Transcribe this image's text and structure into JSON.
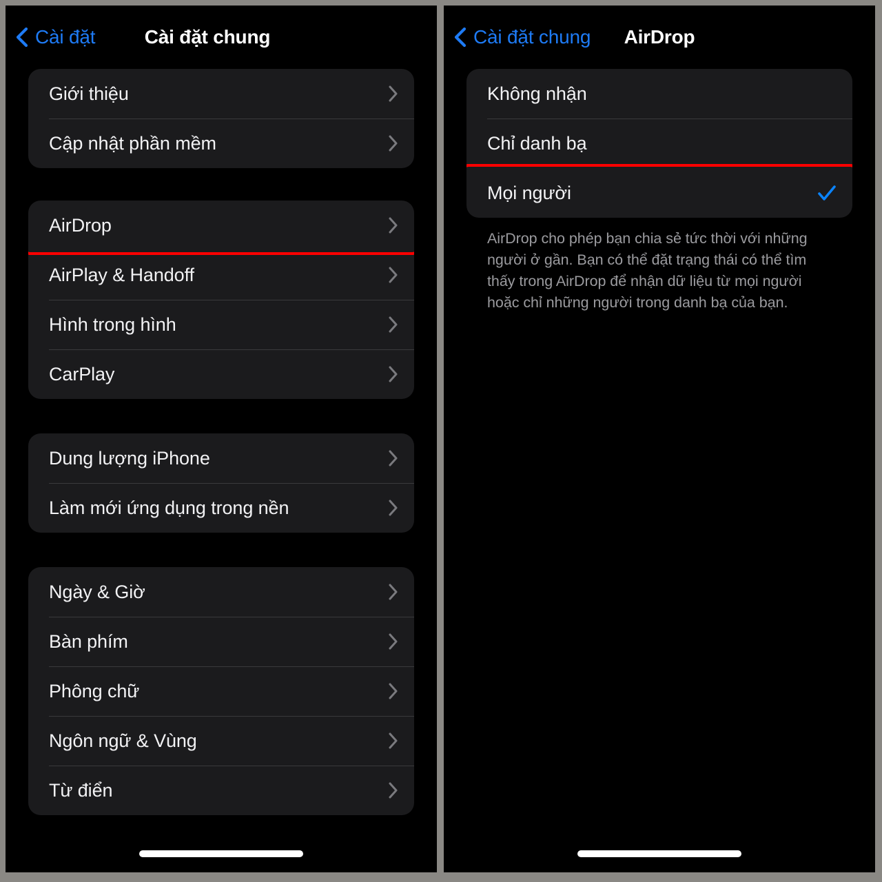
{
  "left_panel": {
    "nav": {
      "back_label": "Cài đặt",
      "title": "Cài đặt chung",
      "back_icon": "chevron-left-icon"
    },
    "groups": [
      {
        "rows": [
          {
            "label": "Giới thiệu",
            "accessory": "chevron-right-icon"
          },
          {
            "label": "Cập nhật phần mềm",
            "accessory": "chevron-right-icon"
          }
        ]
      },
      {
        "rows": [
          {
            "label": "AirDrop",
            "accessory": "chevron-right-icon",
            "highlighted": true
          },
          {
            "label": "AirPlay & Handoff",
            "accessory": "chevron-right-icon"
          },
          {
            "label": "Hình trong hình",
            "accessory": "chevron-right-icon"
          },
          {
            "label": "CarPlay",
            "accessory": "chevron-right-icon"
          }
        ]
      },
      {
        "rows": [
          {
            "label": "Dung lượng iPhone",
            "accessory": "chevron-right-icon"
          },
          {
            "label": "Làm mới ứng dụng trong nền",
            "accessory": "chevron-right-icon"
          }
        ]
      },
      {
        "rows": [
          {
            "label": "Ngày & Giờ",
            "accessory": "chevron-right-icon"
          },
          {
            "label": "Bàn phím",
            "accessory": "chevron-right-icon"
          },
          {
            "label": "Phông chữ",
            "accessory": "chevron-right-icon"
          },
          {
            "label": "Ngôn ngữ & Vùng",
            "accessory": "chevron-right-icon"
          },
          {
            "label": "Từ điển",
            "accessory": "chevron-right-icon"
          }
        ]
      }
    ]
  },
  "right_panel": {
    "nav": {
      "back_label": "Cài đặt chung",
      "title": "AirDrop",
      "back_icon": "chevron-left-icon"
    },
    "options": [
      {
        "label": "Không nhận",
        "selected": false
      },
      {
        "label": "Chỉ danh bạ",
        "selected": false
      },
      {
        "label": "Mọi người",
        "selected": true,
        "highlighted": true,
        "accessory": "checkmark-icon"
      }
    ],
    "footnote": "AirDrop cho phép bạn chia sẻ tức thời với những người ở gần. Bạn có thể đặt trạng thái có thể tìm thấy trong AirDrop để nhận dữ liệu từ mọi người hoặc chỉ những người trong danh bạ của bạn."
  },
  "colors": {
    "accent_blue": "#0A84FF",
    "link_blue": "#1E7BF5",
    "highlight_red": "#FF0000",
    "card_bg": "#1B1B1D",
    "page_bg": "#000000",
    "outer_bg": "#8A8884",
    "separator": "#3A3A3C",
    "footnote_text": "#9B9B9F"
  }
}
